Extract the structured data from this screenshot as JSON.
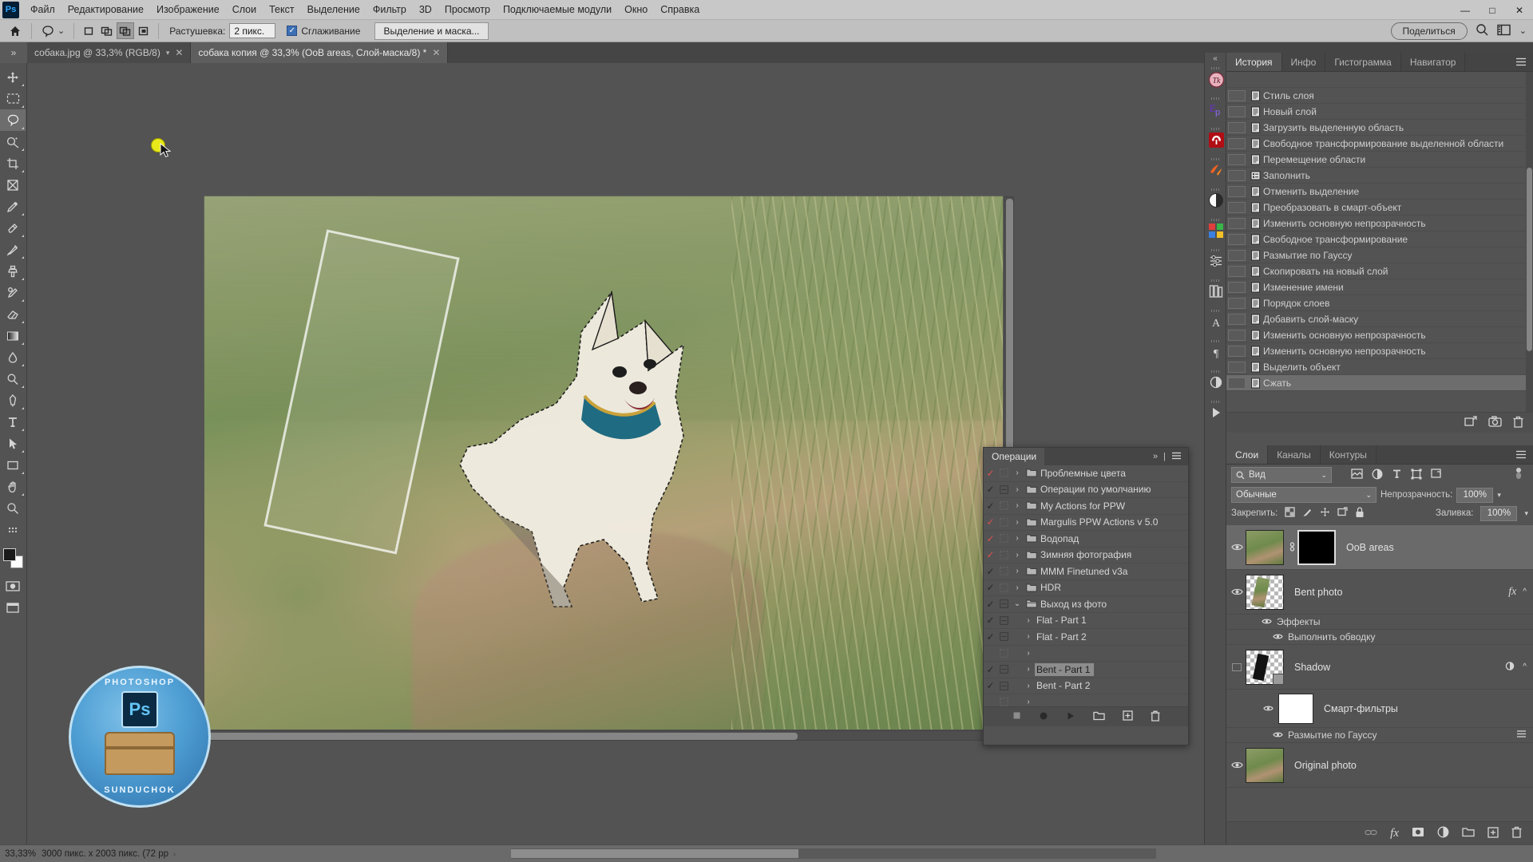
{
  "app": {
    "name": "Adobe Photoshop",
    "logo_text": "Ps"
  },
  "menubar": {
    "items": [
      "Файл",
      "Редактирование",
      "Изображение",
      "Слои",
      "Текст",
      "Выделение",
      "Фильтр",
      "3D",
      "Просмотр",
      "Подключаемые модули",
      "Окно",
      "Справка"
    ],
    "window_controls": {
      "minimize": "—",
      "maximize": "□",
      "close": "✕"
    }
  },
  "options_bar": {
    "home_icon": "home-icon",
    "tool_icon": "lasso-icon",
    "tool_caret": "⌄",
    "selection_modes": [
      "new-selection",
      "add-to-selection",
      "subtract-from-selection",
      "intersect-selection"
    ],
    "active_selection_mode_index": 2,
    "feather_label": "Растушевка:",
    "feather_value": "2 пикс.",
    "antialias_label": "Сглаживание",
    "antialias_checked": true,
    "select_and_mask_label": "Выделение и маска...",
    "share_label": "Поделиться",
    "search_icon": "search-icon",
    "workspace_icon": "workspace-icon",
    "workspace_caret": "⌄"
  },
  "tabs": {
    "overflow_icon": "»",
    "items": [
      {
        "title": "собака.jpg @ 33,3% (RGB/8)",
        "active": false,
        "has_caret": true,
        "close": "✕"
      },
      {
        "title": "собака копия @ 33,3% (OoB areas, Слой-маска/8) *",
        "active": true,
        "has_caret": false,
        "close": "✕"
      }
    ]
  },
  "toolbar": {
    "tools": [
      {
        "name": "move-tool",
        "icon": "move",
        "active": false
      },
      {
        "name": "rectangular-marquee-tool",
        "icon": "marquee",
        "active": false
      },
      {
        "name": "lasso-tool",
        "icon": "lasso",
        "active": true
      },
      {
        "name": "object-selection-tool",
        "icon": "quickselect",
        "active": false
      },
      {
        "name": "crop-tool",
        "icon": "crop",
        "active": false
      },
      {
        "name": "frame-tool",
        "icon": "frame",
        "active": false
      },
      {
        "name": "eyedropper-tool",
        "icon": "eyedropper",
        "active": false
      },
      {
        "name": "spot-healing-brush-tool",
        "icon": "healing",
        "active": false
      },
      {
        "name": "brush-tool",
        "icon": "brush",
        "active": false
      },
      {
        "name": "clone-stamp-tool",
        "icon": "stamp",
        "active": false
      },
      {
        "name": "history-brush-tool",
        "icon": "historybrush",
        "active": false
      },
      {
        "name": "eraser-tool",
        "icon": "eraser",
        "active": false
      },
      {
        "name": "gradient-tool",
        "icon": "gradient",
        "active": false
      },
      {
        "name": "blur-tool",
        "icon": "blur",
        "active": false
      },
      {
        "name": "dodge-tool",
        "icon": "dodge",
        "active": false
      },
      {
        "name": "pen-tool",
        "icon": "pen",
        "active": false
      },
      {
        "name": "type-tool",
        "icon": "type",
        "active": false
      },
      {
        "name": "path-selection-tool",
        "icon": "pathselect",
        "active": false
      },
      {
        "name": "hand-tool",
        "icon": "hand",
        "active": false
      },
      {
        "name": "zoom-tool",
        "icon": "zoom",
        "active": false
      },
      {
        "name": "edit-toolbar-tool",
        "icon": "dots",
        "active": false
      }
    ],
    "foreground_color": "#1a1a1a",
    "background_color": "#fdfdfd",
    "quick_mask_icon": "quick-mask-icon",
    "screen_mode_icon": "screen-mode-icon"
  },
  "canvas": {
    "document_name": "собака копия",
    "bent_frame_label": "bent-photo-frame",
    "watermark": {
      "top_text": "PHOTOSHOP",
      "ps_text": "Ps",
      "bottom_text": "SUNDUCHOK"
    }
  },
  "right_rail": {
    "collapse_icon": "«",
    "plugins": [
      {
        "name": "topaz-labs-icon",
        "label": "Tk",
        "color": "#e6a9b6"
      },
      {
        "name": "exposure-icon",
        "label": "Ep",
        "color": "#8a4fd6"
      },
      {
        "name": "anthropics-icon",
        "label": "A",
        "color": "#b00d15"
      },
      {
        "name": "fluid-mask-icon",
        "label": "fm",
        "color": "#f26322"
      },
      {
        "name": "nik-collection-icon",
        "label": "O",
        "color": "#ffffff"
      },
      {
        "name": "color-efex-icon",
        "label": "C",
        "color": "#4db848"
      },
      {
        "name": "properties-icon",
        "label": "prop",
        "color": "#c8c8c8"
      },
      {
        "name": "libraries-icon",
        "label": "lib",
        "color": "#c8c8c8"
      },
      {
        "name": "character-icon",
        "label": "A",
        "color": "#c8c8c8"
      },
      {
        "name": "paragraph-icon",
        "label": "¶",
        "color": "#c8c8c8"
      },
      {
        "name": "adjustments-icon",
        "label": "adj",
        "color": "#c8c8c8"
      },
      {
        "name": "actions-play-icon",
        "label": "▶",
        "color": "#c8c8c8"
      }
    ]
  },
  "history_panel": {
    "tabs": [
      {
        "label": "История",
        "active": true
      },
      {
        "label": "Инфо",
        "active": false
      },
      {
        "label": "Гистограмма",
        "active": false
      },
      {
        "label": "Навигатор",
        "active": false
      }
    ],
    "menu_icon": "panel-menu-icon",
    "items": [
      {
        "label": "Стиль слоя",
        "selected": false
      },
      {
        "label": "Новый слой",
        "selected": false
      },
      {
        "label": "Загрузить выделенную область",
        "selected": false
      },
      {
        "label": "Свободное трансформирование выделенной области",
        "selected": false
      },
      {
        "label": "Перемещение области",
        "selected": false
      },
      {
        "label": "Заполнить",
        "selected": false,
        "icon": "fill"
      },
      {
        "label": "Отменить выделение",
        "selected": false
      },
      {
        "label": "Преобразовать в смарт-объект",
        "selected": false
      },
      {
        "label": "Изменить основную непрозрачность",
        "selected": false
      },
      {
        "label": "Свободное трансформирование",
        "selected": false
      },
      {
        "label": "Размытие по Гауссу",
        "selected": false
      },
      {
        "label": "Скопировать на новый слой",
        "selected": false
      },
      {
        "label": "Изменение имени",
        "selected": false
      },
      {
        "label": "Порядок слоев",
        "selected": false
      },
      {
        "label": "Добавить слой-маску",
        "selected": false
      },
      {
        "label": "Изменить основную непрозрачность",
        "selected": false
      },
      {
        "label": "Изменить основную непрозрачность",
        "selected": false
      },
      {
        "label": "Выделить объект",
        "selected": false
      },
      {
        "label": "Сжать",
        "selected": true
      }
    ],
    "footer_icons": [
      "create-document-from-state-icon",
      "create-snapshot-icon",
      "delete-state-icon"
    ]
  },
  "layers_panel": {
    "tabs": [
      {
        "label": "Слои",
        "active": true
      },
      {
        "label": "Каналы",
        "active": false
      },
      {
        "label": "Контуры",
        "active": false
      }
    ],
    "menu_icon": "panel-menu-icon",
    "filter_label": "Вид",
    "filter_caret": "⌄",
    "filter_kind_icons": [
      "pixel-filter-icon",
      "adjustment-filter-icon",
      "type-filter-icon",
      "shape-filter-icon",
      "smartobject-filter-icon"
    ],
    "filter_toggle_icon": "filter-toggle-icon",
    "blend_mode": "Обычные",
    "blend_caret": "⌄",
    "opacity_label": "Непрозрачность:",
    "opacity_value": "100%",
    "lock_label": "Закрепить:",
    "lock_icons": [
      "lock-transparent-pixels-icon",
      "lock-image-pixels-icon",
      "lock-position-icon",
      "lock-artboard-nesting-icon",
      "lock-all-icon"
    ],
    "fill_label": "Заливка:",
    "fill_value": "100%",
    "layers": [
      {
        "name": "OoB areas",
        "visible": true,
        "selected": true,
        "type": "masked",
        "thumb": "photo",
        "mask_thumb": "black",
        "linked": true,
        "badges": []
      },
      {
        "name": "Bent photo",
        "visible": true,
        "selected": false,
        "type": "normal",
        "thumb": "checker-bent",
        "badges": [
          "fx",
          "collapse-caret"
        ],
        "children": [
          {
            "label": "Эффекты",
            "visible": true,
            "indent": 1
          },
          {
            "label": "Выполнить обводку",
            "visible": true,
            "indent": 2
          }
        ]
      },
      {
        "name": "Shadow",
        "visible": false,
        "selected": false,
        "type": "smart",
        "thumb": "checker-shadow",
        "badges": [
          "smart-filter-icon",
          "collapse-caret"
        ],
        "children": [
          {
            "label": "Смарт-фильтры",
            "visible": true,
            "indent": 1,
            "has_thumb": true
          },
          {
            "label": "Размытие по Гауссу",
            "visible": true,
            "indent": 2,
            "right_icon": "filter-settings-icon"
          }
        ]
      },
      {
        "name": "Original photo",
        "visible": true,
        "selected": false,
        "type": "normal",
        "thumb": "photo",
        "badges": []
      }
    ],
    "footer_icons": [
      "link-layers-icon",
      "layer-style-fx-icon",
      "add-layer-mask-icon",
      "new-adjustment-layer-icon",
      "new-group-icon",
      "new-layer-icon",
      "delete-layer-icon"
    ]
  },
  "actions_panel": {
    "title": "Операции",
    "collapse_icon": "»",
    "menu_icon": "panel-menu-icon",
    "rows": [
      {
        "label": "Проблемные цвета",
        "checked": true,
        "check_color": "red",
        "box": false,
        "arrow": "›",
        "folder": true,
        "indent": 0,
        "selected": false
      },
      {
        "label": "Операции по умолчанию",
        "checked": true,
        "check_color": "dark",
        "box": true,
        "arrow": "›",
        "folder": true,
        "indent": 0,
        "selected": false
      },
      {
        "label": "My Actions for PPW",
        "checked": true,
        "check_color": "dark",
        "box": false,
        "arrow": "›",
        "folder": true,
        "indent": 0,
        "selected": false
      },
      {
        "label": "Margulis PPW Actions v 5.0",
        "checked": true,
        "check_color": "red",
        "box": false,
        "arrow": "›",
        "folder": true,
        "indent": 0,
        "selected": false
      },
      {
        "label": "Водопад",
        "checked": true,
        "check_color": "red",
        "box": false,
        "arrow": "›",
        "folder": true,
        "indent": 0,
        "selected": false
      },
      {
        "label": "Зимняя фотография",
        "checked": true,
        "check_color": "red",
        "box": false,
        "arrow": "›",
        "folder": true,
        "indent": 0,
        "selected": false
      },
      {
        "label": "MMM Finetuned v3a",
        "checked": true,
        "check_color": "dark",
        "box": false,
        "arrow": "›",
        "folder": true,
        "indent": 0,
        "selected": false
      },
      {
        "label": "HDR",
        "checked": true,
        "check_color": "dark",
        "box": false,
        "arrow": "›",
        "folder": true,
        "indent": 0,
        "selected": false
      },
      {
        "label": "Выход из фото",
        "checked": true,
        "check_color": "dark",
        "box": true,
        "arrow": "⌄",
        "folder": true,
        "indent": 0,
        "selected": false
      },
      {
        "label": "Flat - Part 1",
        "checked": true,
        "check_color": "dark",
        "box": true,
        "arrow": "›",
        "folder": false,
        "indent": 1,
        "selected": false
      },
      {
        "label": "Flat - Part 2",
        "checked": true,
        "check_color": "dark",
        "box": true,
        "arrow": "›",
        "folder": false,
        "indent": 1,
        "selected": false
      },
      {
        "label": "",
        "checked": false,
        "check_color": "none",
        "box": false,
        "arrow": "›",
        "folder": false,
        "indent": 1,
        "selected": false
      },
      {
        "label": "Bent - Part 1",
        "checked": true,
        "check_color": "dark",
        "box": true,
        "arrow": "›",
        "folder": false,
        "indent": 1,
        "selected": true
      },
      {
        "label": "Bent - Part 2",
        "checked": true,
        "check_color": "dark",
        "box": true,
        "arrow": "›",
        "folder": false,
        "indent": 1,
        "selected": false
      },
      {
        "label": "",
        "checked": false,
        "check_color": "none",
        "box": false,
        "arrow": "›",
        "folder": false,
        "indent": 1,
        "selected": false
      }
    ],
    "footer_icons": [
      "stop-icon",
      "record-icon",
      "play-icon",
      "new-set-icon",
      "new-action-icon",
      "delete-icon"
    ]
  },
  "statusbar": {
    "zoom": "33,33%",
    "doc_info": "3000 пикс. x 2003 пикс. (72 pp",
    "doc_info_caret": "›"
  }
}
